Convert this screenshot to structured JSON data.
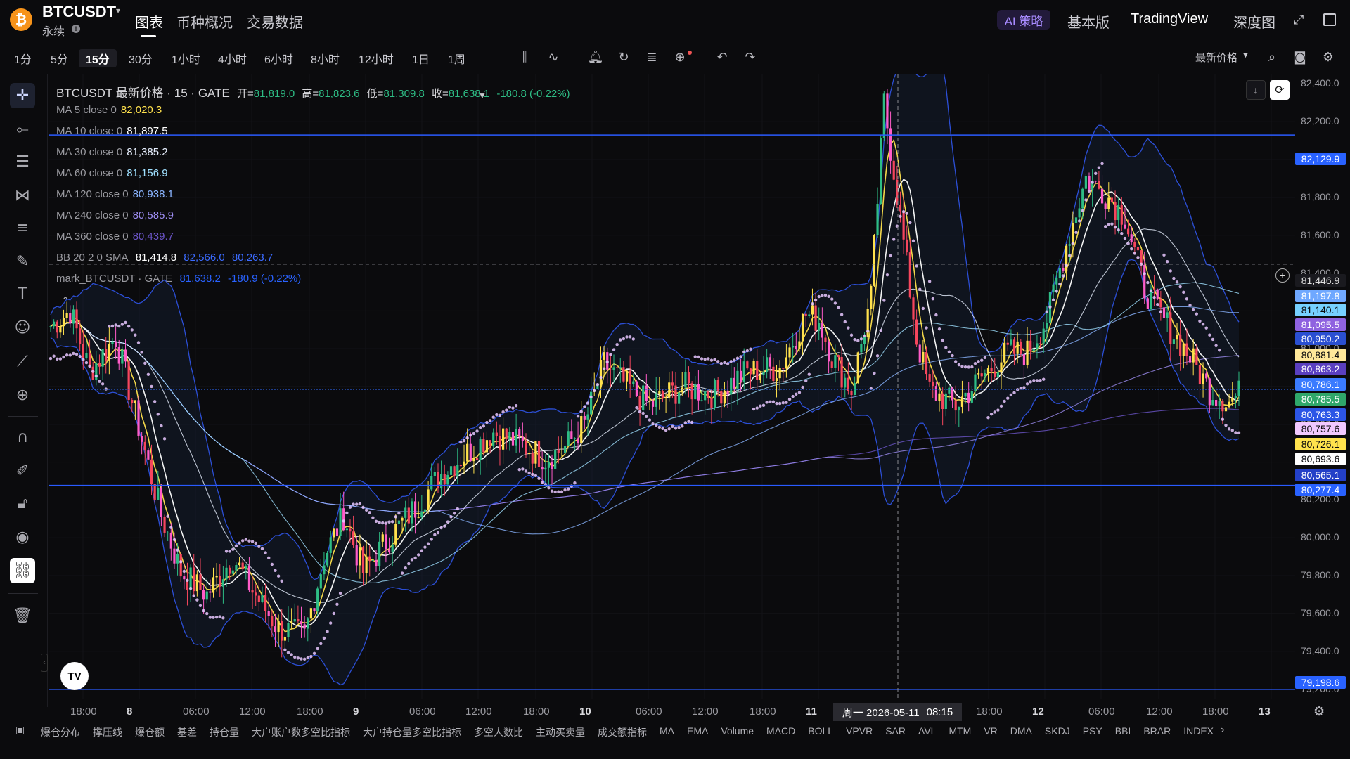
{
  "header": {
    "symbol": "BTCUSDT",
    "contract_type": "永续",
    "tabs": [
      {
        "label": "图表",
        "active": true
      },
      {
        "label": "币种概况"
      },
      {
        "label": "交易数据"
      }
    ],
    "ai_badge": "AI 策略",
    "right_tabs": [
      "基本版",
      "TradingView",
      "深度图"
    ]
  },
  "toolbar": {
    "intervals": [
      "1分",
      "5分",
      "15分",
      "30分",
      "1小时",
      "4小时",
      "6小时",
      "8小时",
      "12小时",
      "1日",
      "1周"
    ],
    "active_interval": "15分",
    "price_type": "最新价格"
  },
  "legend": {
    "title": "BTCUSDT 最新价格 · 15 · GATE",
    "ohlc": {
      "open_label": "开=",
      "open": "81,819.0",
      "high_label": "高=",
      "high": "81,823.6",
      "low_label": "低=",
      "low": "81,309.8",
      "close_label": "收=",
      "close": "81,638.1",
      "change": "-180.8 (-0.22%)"
    },
    "ma": [
      {
        "label": "MA 5 close 0",
        "value": "82,020.3",
        "color": "#ffe14d"
      },
      {
        "label": "MA 10 close 0",
        "value": "81,897.5",
        "color": "#ffffff"
      },
      {
        "label": "MA 30 close 0",
        "value": "81,385.2",
        "color": "#e8f0ff"
      },
      {
        "label": "MA 60 close 0",
        "value": "81,156.9",
        "color": "#9fe0ff"
      },
      {
        "label": "MA 120 close 0",
        "value": "80,938.1",
        "color": "#8ab4ff"
      },
      {
        "label": "MA 240 close 0",
        "value": "80,585.9",
        "color": "#9c8cf0"
      },
      {
        "label": "MA 360 close 0",
        "value": "80,439.7",
        "color": "#6b55c8"
      }
    ],
    "bb": {
      "label": "BB 20 2 0 SMA",
      "mid": "81,414.8",
      "up": "82,566.0",
      "dn": "80,263.7"
    },
    "mark": {
      "label": "mark_BTCUSDT · GATE",
      "value": "81,638.2",
      "change": "-180.9 (-0.22%)"
    }
  },
  "price_axis": [
    "82,400.0",
    "82,200.0",
    "82,000.0",
    "81,800.0",
    "81,600.0",
    "81,400.0",
    "81,200.0",
    "81,000.0",
    "80,800.0",
    "80,600.0",
    "80,400.0",
    "80,200.0",
    "80,000.0",
    "79,800.0",
    "79,600.0",
    "79,400.0",
    "79,200.0"
  ],
  "price_pills": [
    {
      "value": "82,129.9",
      "bg": "#2962ff",
      "fg": "#ffffff"
    },
    {
      "value": "81,446.9",
      "bg": "#1a1a1f",
      "fg": "#e0e0e0"
    },
    {
      "value": "81,197.8",
      "bg": "#6fa8ff",
      "fg": "#ffffff"
    },
    {
      "value": "81,140.1",
      "bg": "#76d0ff",
      "fg": "#0b0b0d"
    },
    {
      "value": "81,095.5",
      "bg": "#8f62e0",
      "fg": "#ffffff"
    },
    {
      "value": "80,950.2",
      "bg": "#2a4fd1",
      "fg": "#ffffff"
    },
    {
      "value": "80,881.4",
      "bg": "#ffe89a",
      "fg": "#0b0b0d"
    },
    {
      "value": "80,863.2",
      "bg": "#5a3fc0",
      "fg": "#ffffff"
    },
    {
      "value": "80,786.1",
      "bg": "#3a7bff",
      "fg": "#ffffff"
    },
    {
      "value": "80,785.5",
      "bg": "#2fa76a",
      "fg": "#ffffff"
    },
    {
      "value": "80,763.3",
      "bg": "#2c55e6",
      "fg": "#ffffff"
    },
    {
      "value": "80,757.6",
      "bg": "#f1c8ff",
      "fg": "#0b0b0d"
    },
    {
      "value": "80,726.1",
      "bg": "#ffe24d",
      "fg": "#0b0b0d"
    },
    {
      "value": "80,693.6",
      "bg": "#ffffff",
      "fg": "#0b0b0d"
    },
    {
      "value": "80,565.1",
      "bg": "#2340c8",
      "fg": "#ffffff"
    },
    {
      "value": "80,277.4",
      "bg": "#2962ff",
      "fg": "#ffffff"
    },
    {
      "value": "79,198.6",
      "bg": "#2962ff",
      "fg": "#ffffff"
    }
  ],
  "time_axis": [
    "18:00",
    "8",
    "06:00",
    "12:00",
    "18:00",
    "9",
    "06:00",
    "12:00",
    "18:00",
    "10",
    "06:00",
    "12:00",
    "18:00",
    "11",
    "18:00",
    "12",
    "06:00",
    "12:00",
    "18:00",
    "13"
  ],
  "crosshair_label": {
    "date": "周一 2026-05-11",
    "time": "08:15"
  },
  "indicators": [
    "爆仓分布",
    "撑压线",
    "爆仓额",
    "基差",
    "持仓量",
    "大户账户数多空比指标",
    "大户持仓量多空比指标",
    "多空人数比",
    "主动买卖量",
    "成交额指标",
    "MA",
    "EMA",
    "Volume",
    "MACD",
    "BOLL",
    "VPVR",
    "SAR",
    "AVL",
    "MTM",
    "VR",
    "DMA",
    "SKDJ",
    "PSY",
    "BBI",
    "BRAR",
    "INDEX"
  ],
  "chart_data": {
    "type": "candlestick",
    "y_range": [
      79150,
      82450
    ],
    "approx_close_path": [
      [
        0,
        81120
      ],
      [
        6,
        81200
      ],
      [
        12,
        80880
      ],
      [
        20,
        81060
      ],
      [
        28,
        80520
      ],
      [
        34,
        80120
      ],
      [
        40,
        79820
      ],
      [
        48,
        79700
      ],
      [
        56,
        79900
      ],
      [
        62,
        79720
      ],
      [
        70,
        79520
      ],
      [
        78,
        79480
      ],
      [
        84,
        79900
      ],
      [
        90,
        80120
      ],
      [
        96,
        79820
      ],
      [
        104,
        80000
      ],
      [
        112,
        80160
      ],
      [
        120,
        80340
      ],
      [
        128,
        80450
      ],
      [
        136,
        80560
      ],
      [
        144,
        80500
      ],
      [
        152,
        80420
      ],
      [
        158,
        80480
      ],
      [
        164,
        80600
      ],
      [
        170,
        80920
      ],
      [
        176,
        80820
      ],
      [
        184,
        80700
      ],
      [
        194,
        80800
      ],
      [
        204,
        80760
      ],
      [
        214,
        80880
      ],
      [
        224,
        80900
      ],
      [
        232,
        81180
      ],
      [
        236,
        81150
      ],
      [
        240,
        80960
      ],
      [
        246,
        80780
      ],
      [
        252,
        81270
      ],
      [
        256,
        82300
      ],
      [
        260,
        81820
      ],
      [
        266,
        81050
      ],
      [
        270,
        80780
      ],
      [
        278,
        80700
      ],
      [
        286,
        80850
      ],
      [
        294,
        80980
      ],
      [
        300,
        80980
      ],
      [
        306,
        81160
      ],
      [
        312,
        81550
      ],
      [
        318,
        81900
      ],
      [
        324,
        81820
      ],
      [
        330,
        81700
      ],
      [
        336,
        81320
      ],
      [
        342,
        81150
      ],
      [
        350,
        80960
      ],
      [
        356,
        80780
      ],
      [
        362,
        80720
      ],
      [
        365,
        80760
      ]
    ],
    "horizontal_lines": [
      82129.9,
      80785.5,
      80277.4,
      79198.6
    ],
    "crosshair_price": 81446.9
  }
}
